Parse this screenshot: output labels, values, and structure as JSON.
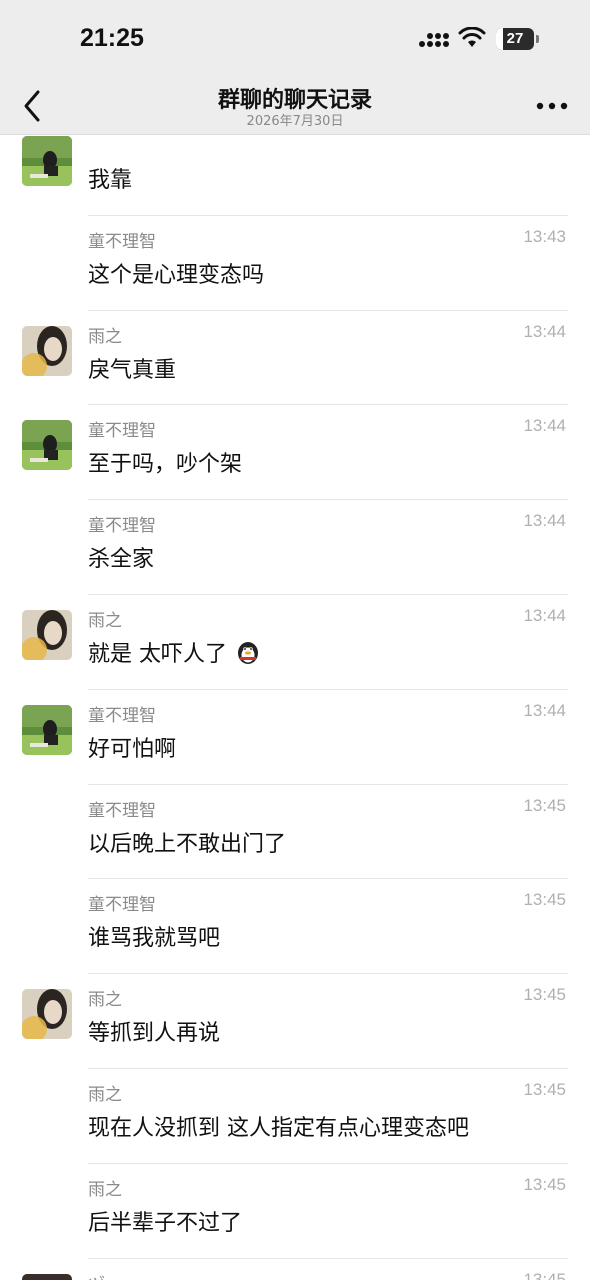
{
  "status_bar": {
    "time": "21:25",
    "battery": "27",
    "icons": [
      "cellular-signal-icon",
      "wifi-icon",
      "battery-icon"
    ]
  },
  "navbar": {
    "title": "群聊的聊天记录",
    "subtitle": "2026年7月30日",
    "back_icon": "chevron-left-icon",
    "more_icon": "more-dots-icon"
  },
  "messages": [
    {
      "sender": "",
      "time": "",
      "text": "我靠",
      "avatar": "tong"
    },
    {
      "sender": "童不理智",
      "time": "13:43",
      "text": "这个是心理变态吗",
      "avatar": ""
    },
    {
      "sender": "雨之",
      "time": "13:44",
      "text": "戾气真重",
      "avatar": "yu"
    },
    {
      "sender": "童不理智",
      "time": "13:44",
      "text": "至于吗，吵个架",
      "avatar": "tong"
    },
    {
      "sender": "童不理智",
      "time": "13:44",
      "text": "杀全家",
      "avatar": ""
    },
    {
      "sender": "雨之",
      "time": "13:44",
      "text": "就是 太吓人了",
      "avatar": "yu",
      "emoji": "penguin-emoji-icon"
    },
    {
      "sender": "童不理智",
      "time": "13:44",
      "text": "好可怕啊",
      "avatar": "tong"
    },
    {
      "sender": "童不理智",
      "time": "13:45",
      "text": "以后晚上不敢出门了",
      "avatar": ""
    },
    {
      "sender": "童不理智",
      "time": "13:45",
      "text": "谁骂我就骂吧",
      "avatar": ""
    },
    {
      "sender": "雨之",
      "time": "13:45",
      "text": "等抓到人再说",
      "avatar": "yu"
    },
    {
      "sender": "雨之",
      "time": "13:45",
      "text": "现在人没抓到 这人指定有点心理变态吧",
      "avatar": ""
    },
    {
      "sender": "雨之",
      "time": "13:45",
      "text": "后半辈子不过了",
      "avatar": ""
    },
    {
      "sender": "ヅ",
      "time": "13:45",
      "text": "",
      "avatar": "dark"
    }
  ]
}
